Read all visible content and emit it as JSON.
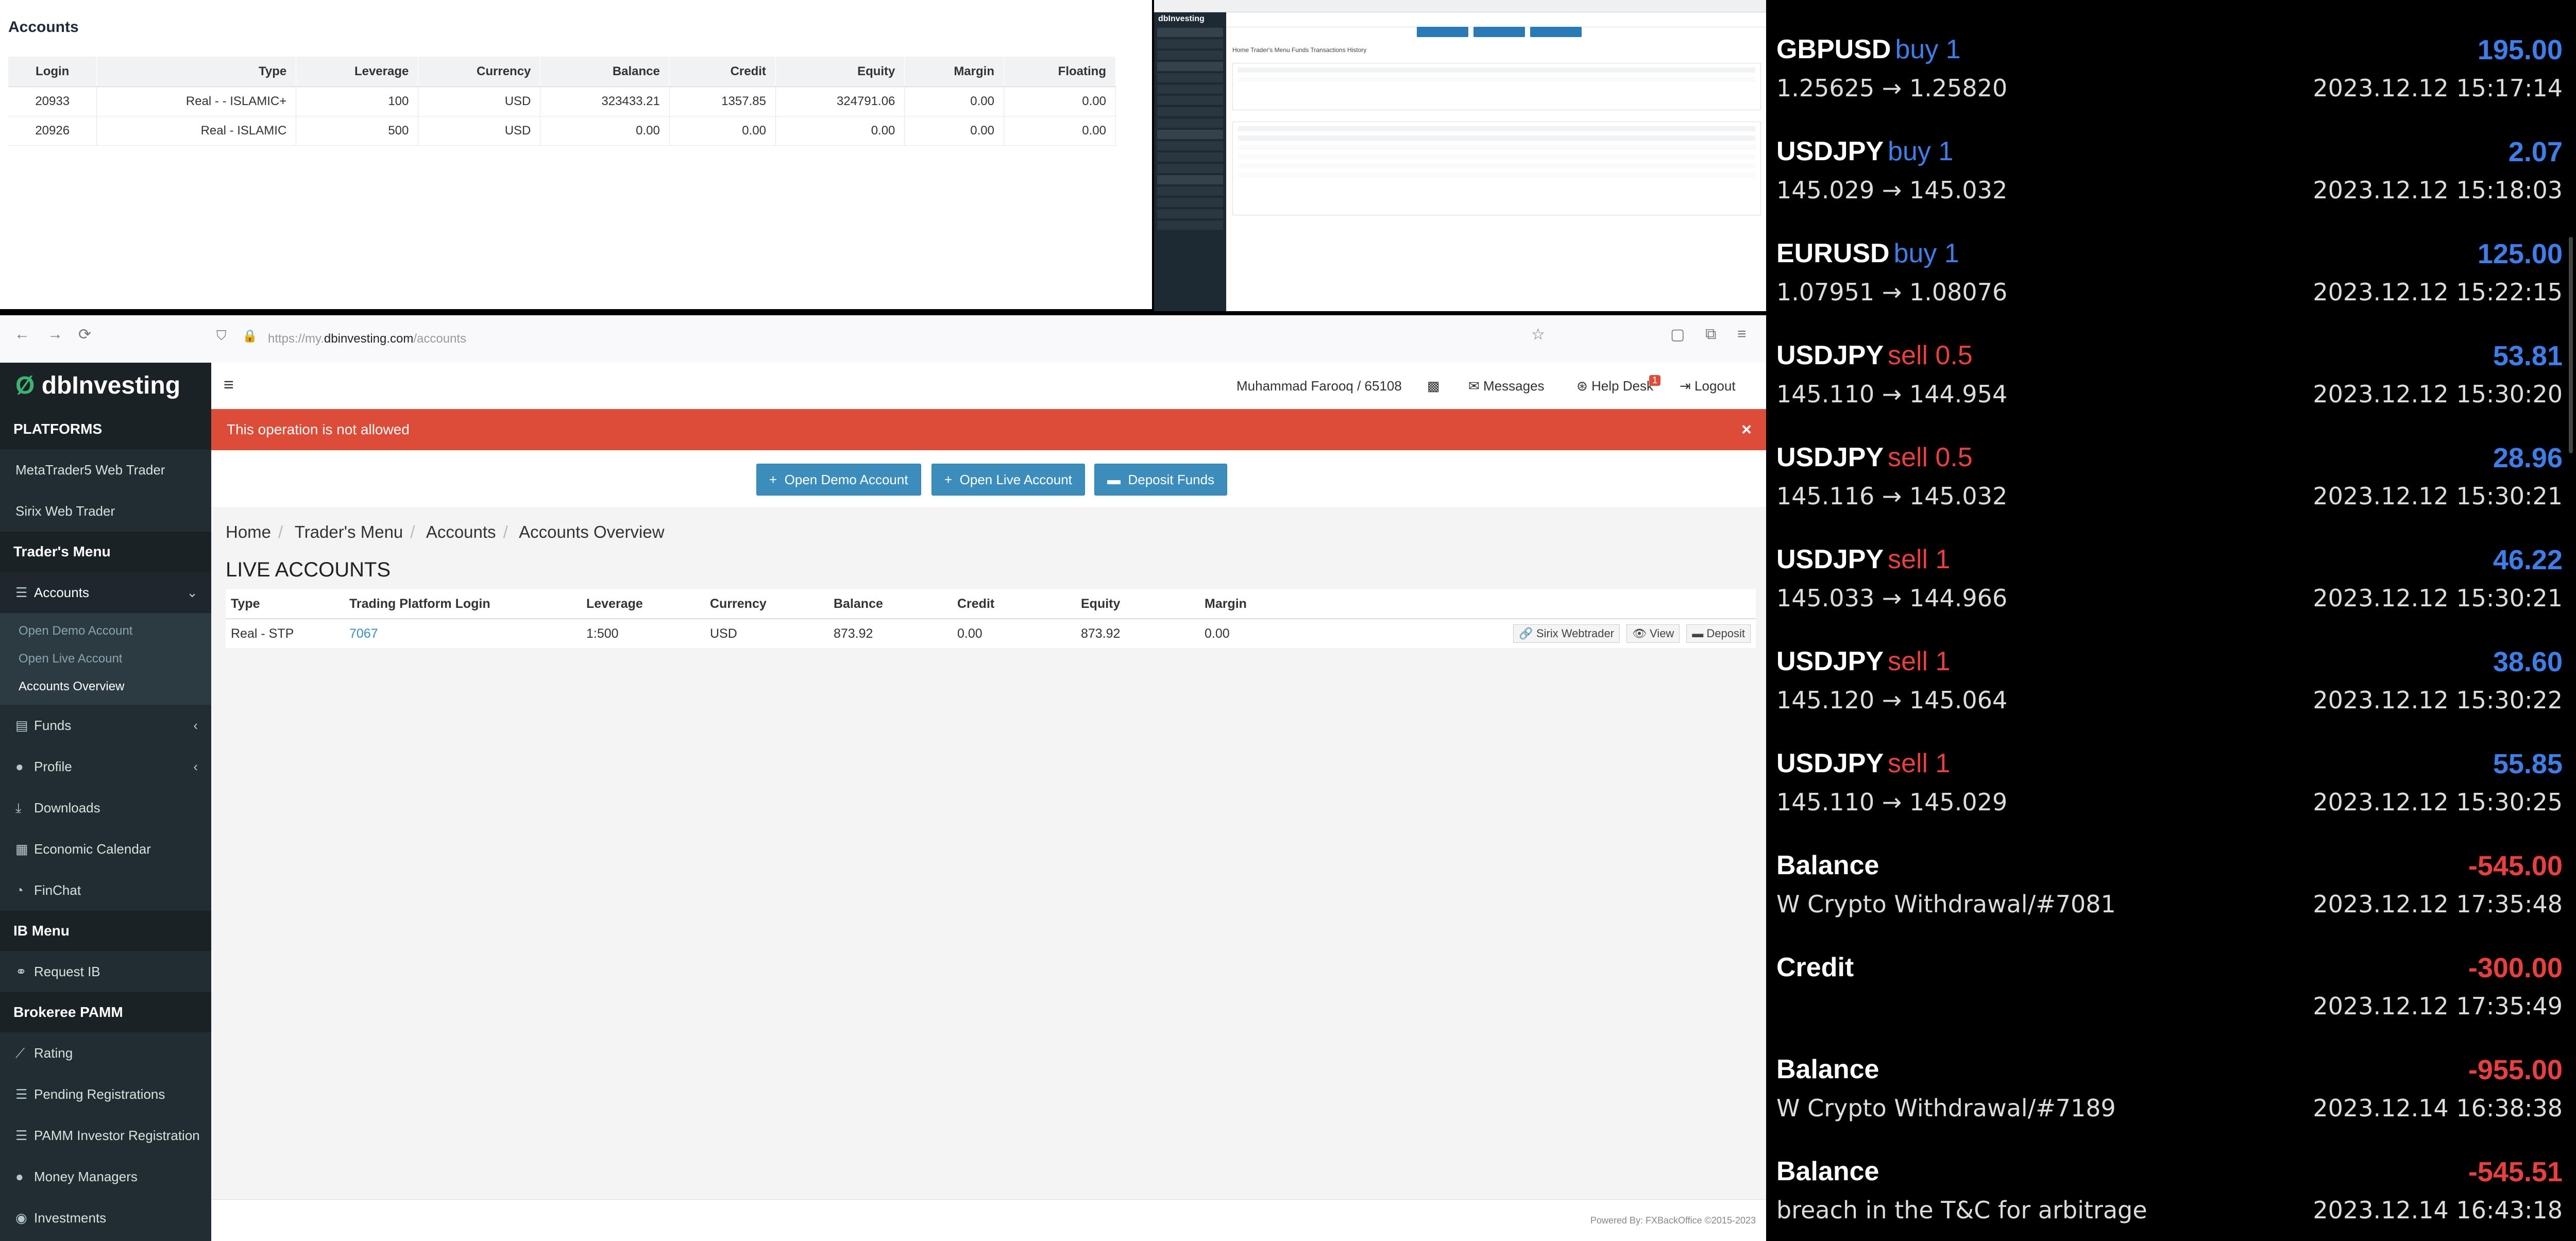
{
  "accounts_panel": {
    "title": "Accounts",
    "columns": [
      "Login",
      "Type",
      "Leverage",
      "Currency",
      "Balance",
      "Credit",
      "Equity",
      "Margin",
      "Floating"
    ],
    "rows": [
      [
        "20933",
        "Real - - ISLAMIC+",
        "100",
        "USD",
        "323433.21",
        "1357.85",
        "324791.06",
        "0.00",
        "0.00"
      ],
      [
        "20926",
        "Real - ISLAMIC",
        "500",
        "USD",
        "0.00",
        "0.00",
        "0.00",
        "0.00",
        "0.00"
      ]
    ]
  },
  "thumbnail": {
    "logo": "dbInvesting",
    "breadcrumb": "Home   Trader's Menu   Funds   Transactions History"
  },
  "browser": {
    "url_prefix": "https://my.",
    "url_domain": "dbinvesting.com",
    "url_path": "/accounts",
    "icons": {
      "back": "←",
      "forward": "→",
      "reload": "⟳",
      "shield": "⛉",
      "lock": "🔒",
      "star": "☆",
      "pocket": "▢",
      "extensions": "⧉",
      "menu": "≡"
    }
  },
  "sidebar": {
    "logo_mark": "Ø",
    "logo_text": "dbInvesting",
    "platforms_header": "PLATFORMS",
    "platforms": [
      "MetaTrader5 Web Trader",
      "Sirix Web Trader"
    ],
    "traders_menu_header": "Trader's Menu",
    "accounts_label": "Accounts",
    "accounts_sub": [
      "Open Demo Account",
      "Open Live Account",
      "Accounts Overview"
    ],
    "items": [
      "Funds",
      "Profile",
      "Downloads",
      "Economic Calendar",
      "FinChat"
    ],
    "ib_header": "IB Menu",
    "ib_items": [
      "Request IB"
    ],
    "pamm_header": "Brokeree PAMM",
    "pamm_items": [
      "Rating",
      "Pending Registrations",
      "PAMM Investor Registration",
      "Money Managers",
      "Investments"
    ]
  },
  "topnav": {
    "user": "Muhammad Farooq / 65108",
    "messages": "Messages",
    "helpdesk": "Help Desk",
    "helpdesk_badge": "1",
    "logout": "Logout"
  },
  "alert": {
    "text": "This operation is not allowed",
    "close": "×"
  },
  "actions": {
    "open_demo": "Open Demo Account",
    "open_live": "Open Live Account",
    "deposit": "Deposit Funds"
  },
  "breadcrumb": [
    "Home",
    "Trader's Menu",
    "Accounts",
    "Accounts Overview"
  ],
  "live_accounts": {
    "heading": "LIVE ACCOUNTS",
    "columns": [
      "Type",
      "Trading Platform Login",
      "Leverage",
      "Currency",
      "Balance",
      "Credit",
      "Equity",
      "Margin"
    ],
    "row": {
      "type": "Real - STP",
      "login": "7067",
      "leverage": "1:500",
      "currency": "USD",
      "balance": "873.92",
      "credit": "0.00",
      "equity": "873.92",
      "margin": "0.00"
    },
    "row_actions": [
      "Sirix Webtrader",
      "View",
      "Deposit"
    ]
  },
  "footer": {
    "text": "Powered By: FXBackOffice ©2015-2023"
  },
  "mt_history": [
    {
      "symbol": "GBPUSD",
      "side": "buy 1",
      "side_color": "#3f7ee8",
      "amount": "195.00",
      "amount_color": "#3f7ee8",
      "detail": "1.25625 → 1.25820",
      "time": "2023.12.12 15:17:14"
    },
    {
      "symbol": "USDJPY",
      "side": "buy 1",
      "side_color": "#3f7ee8",
      "amount": "2.07",
      "amount_color": "#3f7ee8",
      "detail": "145.029 → 145.032",
      "time": "2023.12.12 15:18:03"
    },
    {
      "symbol": "EURUSD",
      "side": "buy 1",
      "side_color": "#3f7ee8",
      "amount": "125.00",
      "amount_color": "#3f7ee8",
      "detail": "1.07951 → 1.08076",
      "time": "2023.12.12 15:22:15"
    },
    {
      "symbol": "USDJPY",
      "side": "sell 0.5",
      "side_color": "#e84040",
      "amount": "53.81",
      "amount_color": "#3f7ee8",
      "detail": "145.110 → 144.954",
      "time": "2023.12.12 15:30:20"
    },
    {
      "symbol": "USDJPY",
      "side": "sell 0.5",
      "side_color": "#e84040",
      "amount": "28.96",
      "amount_color": "#3f7ee8",
      "detail": "145.116 → 145.032",
      "time": "2023.12.12 15:30:21"
    },
    {
      "symbol": "USDJPY",
      "side": "sell 1",
      "side_color": "#e84040",
      "amount": "46.22",
      "amount_color": "#3f7ee8",
      "detail": "145.033 → 144.966",
      "time": "2023.12.12 15:30:21"
    },
    {
      "symbol": "USDJPY",
      "side": "sell 1",
      "side_color": "#e84040",
      "amount": "38.60",
      "amount_color": "#3f7ee8",
      "detail": "145.120 → 145.064",
      "time": "2023.12.12 15:30:22"
    },
    {
      "symbol": "USDJPY",
      "side": "sell 1",
      "side_color": "#e84040",
      "amount": "55.85",
      "amount_color": "#3f7ee8",
      "detail": "145.110 → 145.029",
      "time": "2023.12.12 15:30:25"
    },
    {
      "symbol": "Balance",
      "side": "",
      "side_color": "#ffffff",
      "amount": "-545.00",
      "amount_color": "#e84040",
      "detail": "W Crypto Withdrawal/#7081",
      "time": "2023.12.12 17:35:48"
    },
    {
      "symbol": "Credit",
      "side": "",
      "side_color": "#ffffff",
      "amount": "-300.00",
      "amount_color": "#e84040",
      "detail": "",
      "time": "2023.12.12 17:35:49"
    },
    {
      "symbol": "Balance",
      "side": "",
      "side_color": "#ffffff",
      "amount": "-955.00",
      "amount_color": "#e84040",
      "detail": "W Crypto Withdrawal/#7189",
      "time": "2023.12.14 16:38:38"
    },
    {
      "symbol": "Balance",
      "side": "",
      "side_color": "#ffffff",
      "amount": "-545.51",
      "amount_color": "#e84040",
      "detail": "breach in the T&C for arbitrage",
      "time": "2023.12.14 16:43:18"
    }
  ]
}
